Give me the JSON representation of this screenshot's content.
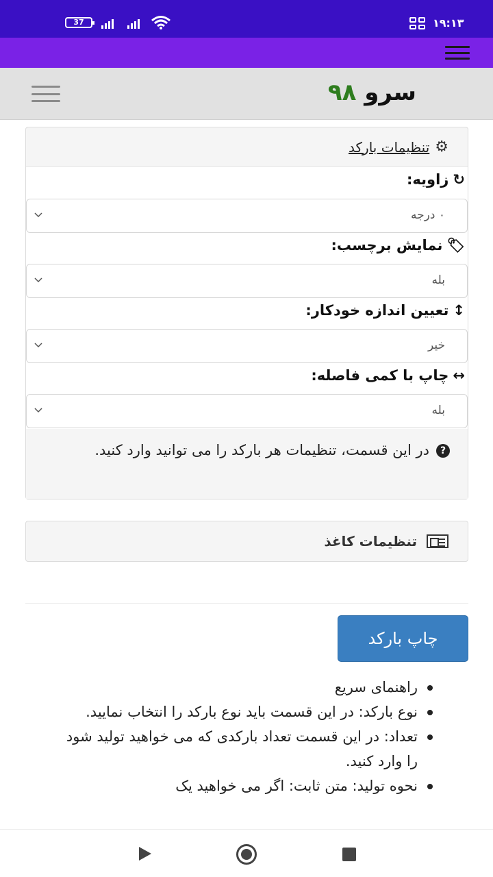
{
  "status_bar": {
    "battery": "37",
    "time": "۱۹:۱۳"
  },
  "header": {
    "brand_part1": "سرو",
    "brand_part2": "۹۸"
  },
  "barcode_settings": {
    "title": "تنظیمات بارکد",
    "fields": [
      {
        "label": "زاویه:",
        "icon": "rotate-icon",
        "value": "۰ درجه"
      },
      {
        "label": "نمایش برچسب:",
        "icon": "tag-icon",
        "value": "بله"
      },
      {
        "label": "تعیین اندازه خودکار:",
        "icon": "vertical-resize-icon",
        "value": "خیر"
      },
      {
        "label": "چاپ با کمی فاصله:",
        "icon": "horizontal-resize-icon",
        "value": "بله"
      }
    ],
    "help_text": "در این قسمت، تنظیمات هر بارکد را می توانید وارد کنید."
  },
  "paper_settings": {
    "title": "تنظیمات کاغذ"
  },
  "print_button": "چاپ بارکد",
  "guide": [
    "راهنمای سریع",
    "نوع بارکد: در این قسمت باید نوع بارکد را انتخاب نمایید.",
    "تعداد: در این قسمت تعداد بارکدی که می خواهید تولید شود را وارد کنید.",
    "نحوه تولید: متن ثابت: اگر می خواهید یک"
  ],
  "colors": {
    "status_bar": "#3a10c4",
    "app_bar": "#7a22e6",
    "brand_number": "#2e7d1e",
    "primary_button": "#3a7fc1"
  }
}
